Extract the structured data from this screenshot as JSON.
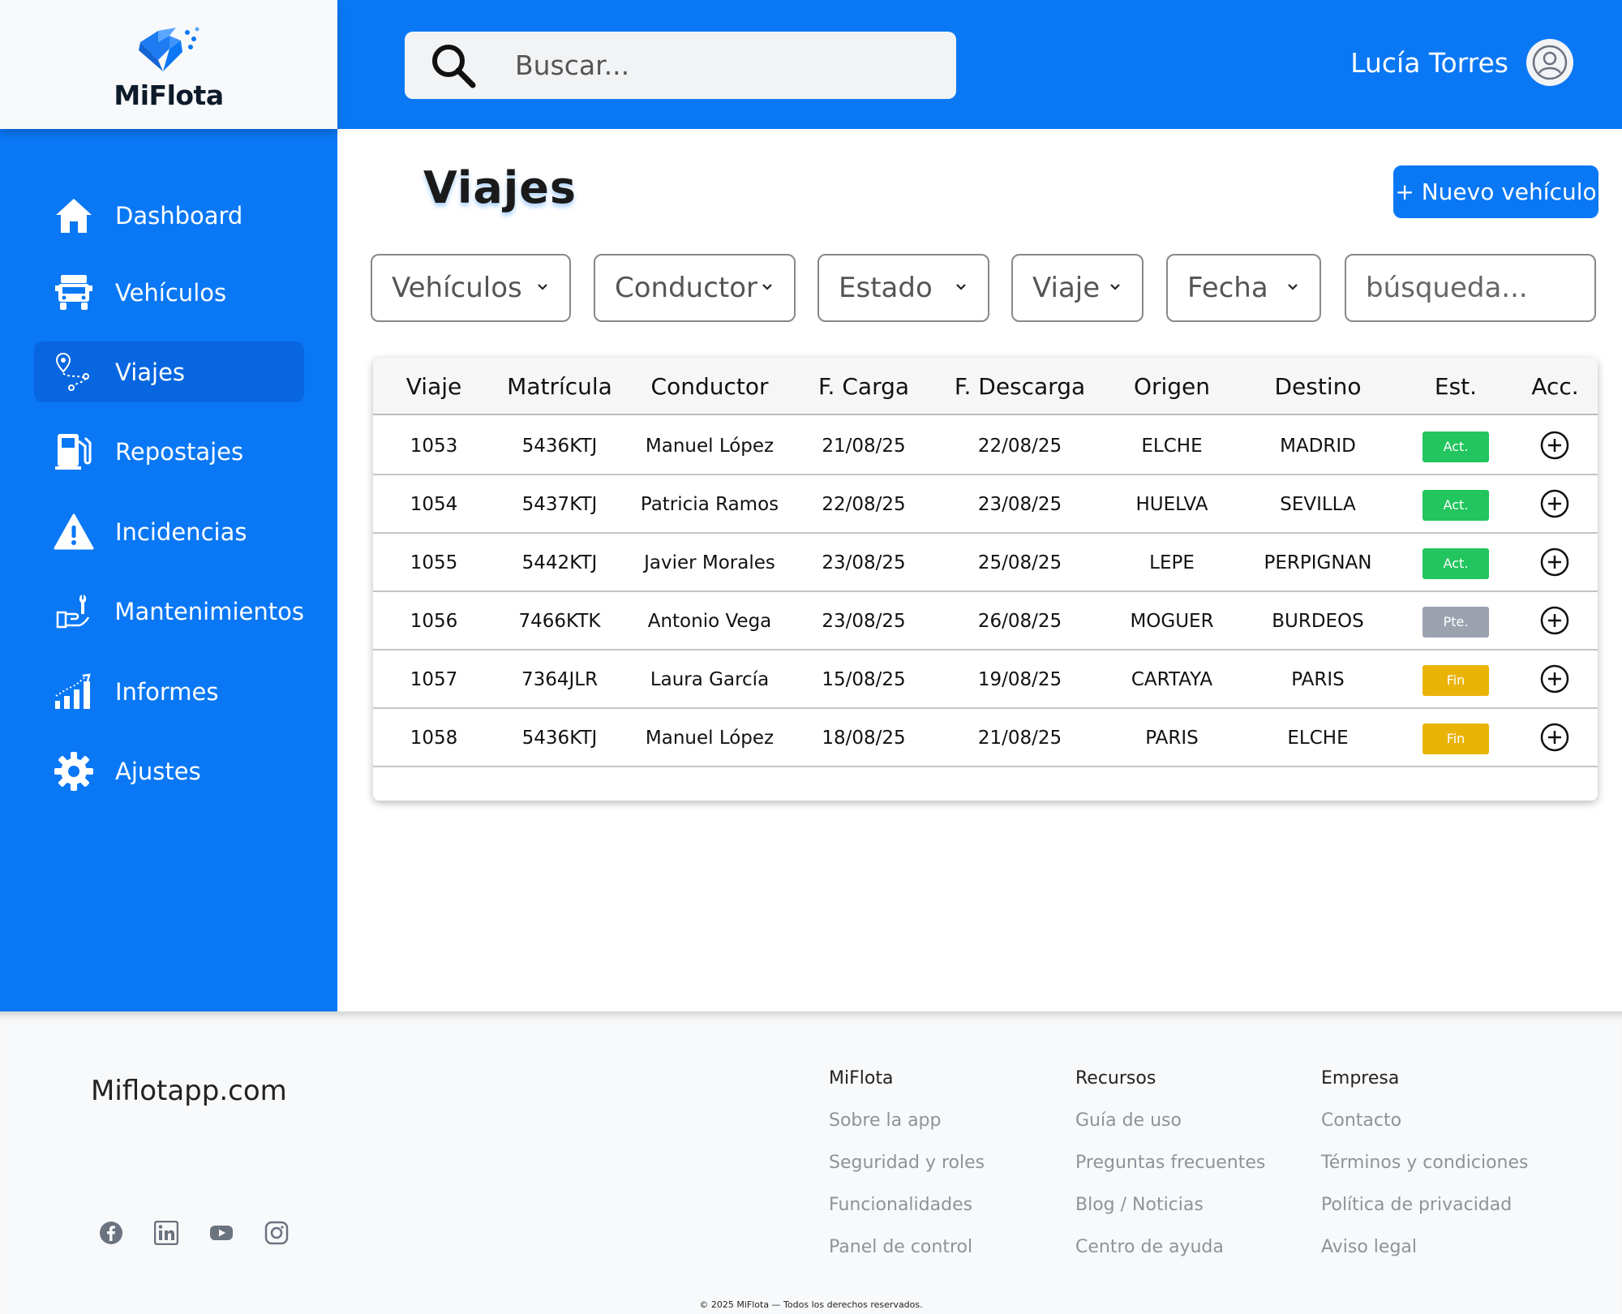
{
  "brand": {
    "name": "MiFlota",
    "accent": "#0a78f5"
  },
  "header": {
    "search_placeholder": "Buscar...",
    "user_name": "Lucía Torres"
  },
  "sidebar": {
    "items": [
      {
        "label": "Dashboard",
        "icon": "home-icon"
      },
      {
        "label": "Vehículos",
        "icon": "truck-icon"
      },
      {
        "label": "Viajes",
        "icon": "route-icon",
        "active": true
      },
      {
        "label": "Repostajes",
        "icon": "fuel-pump-icon"
      },
      {
        "label": "Incidencias",
        "icon": "warning-icon"
      },
      {
        "label": "Mantenimientos",
        "icon": "wrench-hand-icon"
      },
      {
        "label": "Informes",
        "icon": "bar-chart-icon"
      },
      {
        "label": "Ajustes",
        "icon": "gear-icon"
      }
    ]
  },
  "main": {
    "title": "Viajes",
    "new_button": "+ Nuevo vehículo",
    "filters": [
      "Vehículos",
      "Conductor",
      "Estado",
      "Viaje",
      "Fecha"
    ],
    "search_placeholder": "búsqueda..."
  },
  "table": {
    "headers": [
      "Viaje",
      "Matrícula",
      "Conductor",
      "F. Carga",
      "F. Descarga",
      "Origen",
      "Destino",
      "Est.",
      "Acc."
    ],
    "rows": [
      {
        "viaje": "1053",
        "matricula": "5436KTJ",
        "conductor": "Manuel López",
        "carga": "21/08/25",
        "descarga": "22/08/25",
        "origen": "ELCHE",
        "destino": "MADRID",
        "estado": "Act."
      },
      {
        "viaje": "1054",
        "matricula": "5437KTJ",
        "conductor": "Patricia Ramos",
        "carga": "22/08/25",
        "descarga": "23/08/25",
        "origen": "HUELVA",
        "destino": "SEVILLA",
        "estado": "Act."
      },
      {
        "viaje": "1055",
        "matricula": "5442KTJ",
        "conductor": "Javier Morales",
        "carga": "23/08/25",
        "descarga": "25/08/25",
        "origen": "LEPE",
        "destino": "PERPIGNAN",
        "estado": "Act."
      },
      {
        "viaje": "1056",
        "matricula": "7466KTK",
        "conductor": "Antonio Vega",
        "carga": "23/08/25",
        "descarga": "26/08/25",
        "origen": "MOGUER",
        "destino": "BURDEOS",
        "estado": "Pte."
      },
      {
        "viaje": "1057",
        "matricula": "7364JLR",
        "conductor": "Laura García",
        "carga": "15/08/25",
        "descarga": "19/08/25",
        "origen": "CARTAYA",
        "destino": "PARIS",
        "estado": "Fin"
      },
      {
        "viaje": "1058",
        "matricula": "5436KTJ",
        "conductor": "Manuel López",
        "carga": "18/08/25",
        "descarga": "21/08/25",
        "origen": "PARIS",
        "destino": "ELCHE",
        "estado": "Fin"
      }
    ],
    "status_colors": {
      "Act.": "#22c55e",
      "Pte.": "#9ca3af",
      "Fin": "#eab308"
    }
  },
  "footer": {
    "brand": "Miflotapp.com",
    "socials": [
      "facebook-icon",
      "linkedin-icon",
      "youtube-icon",
      "instagram-icon"
    ],
    "columns": [
      {
        "title": "MiFlota",
        "links": [
          "Sobre la app",
          "Seguridad y roles",
          "Funcionalidades",
          "Panel de control"
        ]
      },
      {
        "title": "Recursos",
        "links": [
          "Guía de uso",
          "Preguntas frecuentes",
          "Blog / Noticias",
          "Centro de ayuda"
        ]
      },
      {
        "title": "Empresa",
        "links": [
          "Contacto",
          "Términos y condiciones",
          "Política de privacidad",
          "Aviso legal"
        ]
      }
    ],
    "copyright": "© 2025 MiFlota — Todos los derechos reservados."
  }
}
